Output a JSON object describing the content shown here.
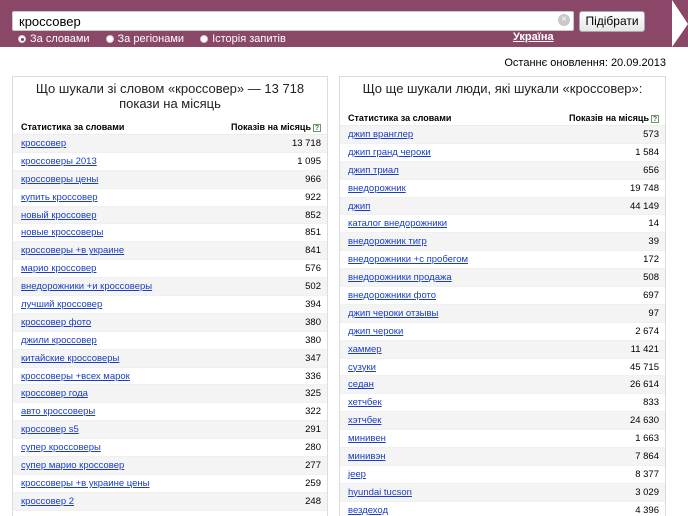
{
  "search": {
    "query": "кроссовер",
    "submit_label": "Підібрати"
  },
  "modes": [
    {
      "label": "За словами",
      "selected": true
    },
    {
      "label": "За регіонами",
      "selected": false
    },
    {
      "label": "Історія запитів",
      "selected": false
    }
  ],
  "region_label": "Україна",
  "updated_text": "Останнє оновлення: 20.09.2013",
  "left_panel": {
    "title": "Що шукали зі словом «кроссовер» — 13 718 покази на місяць",
    "col_keywords": "Статистика за словами",
    "col_count": "Показів на місяць",
    "rows": [
      {
        "kw": "кроссовер",
        "count": "13 718"
      },
      {
        "kw": "кроссоверы 2013",
        "count": "1 095"
      },
      {
        "kw": "кроссоверы цены",
        "count": "966"
      },
      {
        "kw": "купить кроссовер",
        "count": "922"
      },
      {
        "kw": "новый кроссовер",
        "count": "852"
      },
      {
        "kw": "новые кроссоверы",
        "count": "851"
      },
      {
        "kw": "кроссоверы +в украине",
        "count": "841"
      },
      {
        "kw": "марио кроссовер",
        "count": "576"
      },
      {
        "kw": "внедорожники +и кроссоверы",
        "count": "502"
      },
      {
        "kw": "лучший кроссовер",
        "count": "394"
      },
      {
        "kw": "кроссовер фото",
        "count": "380"
      },
      {
        "kw": "джили кроссовер",
        "count": "380"
      },
      {
        "kw": "китайские кроссоверы",
        "count": "347"
      },
      {
        "kw": "кроссоверы +всех марок",
        "count": "336"
      },
      {
        "kw": "кроссовер года",
        "count": "325"
      },
      {
        "kw": "авто кроссоверы",
        "count": "322"
      },
      {
        "kw": "кроссовер s5",
        "count": "291"
      },
      {
        "kw": "супер кроссоверы",
        "count": "280"
      },
      {
        "kw": "супер марио кроссовер",
        "count": "277"
      },
      {
        "kw": "кроссоверы +в украине цены",
        "count": "259"
      },
      {
        "kw": "кроссовер 2",
        "count": "248"
      }
    ]
  },
  "right_panel": {
    "title": "Що ще шукали люди, які шукали «кроссовер»:",
    "col_keywords": "Статистика за словами",
    "col_count": "Показів на місяць",
    "rows": [
      {
        "kw": "джип вранглер",
        "count": "573"
      },
      {
        "kw": "джип гранд чероки",
        "count": "1 584"
      },
      {
        "kw": "джип триал",
        "count": "656"
      },
      {
        "kw": "внедорожник",
        "count": "19 748"
      },
      {
        "kw": "джип",
        "count": "44 149"
      },
      {
        "kw": "каталог внедорожники",
        "count": "14"
      },
      {
        "kw": "внедорожник тигр",
        "count": "39"
      },
      {
        "kw": "внедорожники +с пробегом",
        "count": "172"
      },
      {
        "kw": "внедорожники продажа",
        "count": "508"
      },
      {
        "kw": "внедорожники фото",
        "count": "697"
      },
      {
        "kw": "джип чероки отзывы",
        "count": "97"
      },
      {
        "kw": "джип чероки",
        "count": "2 674"
      },
      {
        "kw": "хаммер",
        "count": "11 421"
      },
      {
        "kw": "сузуки",
        "count": "45 715"
      },
      {
        "kw": "седан",
        "count": "26 614"
      },
      {
        "kw": "хетчбек",
        "count": "833"
      },
      {
        "kw": "хэтчбек",
        "count": "24 630"
      },
      {
        "kw": "минивен",
        "count": "1 663"
      },
      {
        "kw": "минивэн",
        "count": "7 864"
      },
      {
        "kw": "jeep",
        "count": "8 377"
      },
      {
        "kw": "hyundai tucson",
        "count": "3 029"
      },
      {
        "kw": "вездеход",
        "count": "4 396"
      }
    ]
  }
}
